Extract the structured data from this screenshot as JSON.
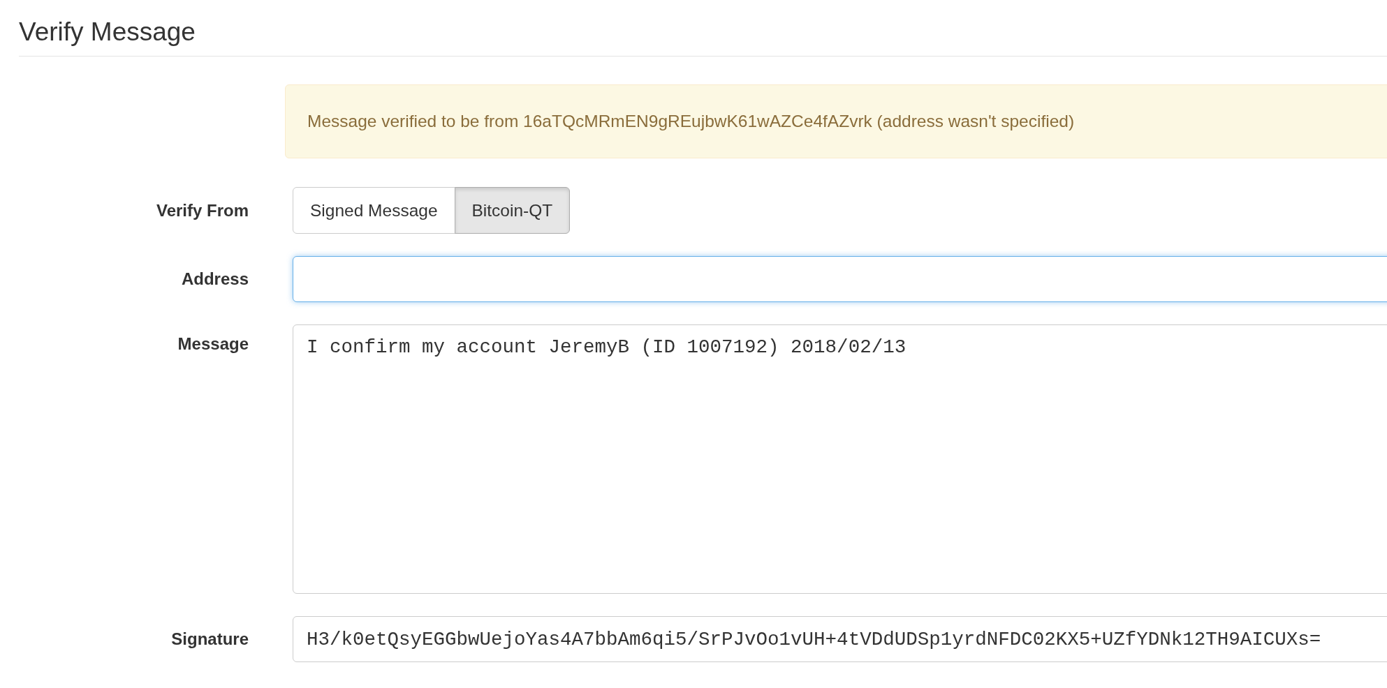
{
  "heading": "Verify Message",
  "alert": {
    "text": "Message verified to be from 16aTQcMRmEN9gREujbwK61wAZCe4fAZvrk (address wasn't specified)"
  },
  "form": [
    {
      "kind": "toggle",
      "label": "Verify From",
      "options": [
        {
          "label": "Signed Message",
          "selected": false
        },
        {
          "label": "Bitcoin-QT",
          "selected": true
        }
      ]
    },
    {
      "kind": "input",
      "label": "Address",
      "focused": true
    },
    {
      "kind": "textarea",
      "label": "Message",
      "value": "I confirm my account JeremyB (ID 1007192) 2018/02/13"
    },
    {
      "kind": "input",
      "label": "Signature",
      "value": "H3/k0etQsyEGGbwUejoYas4A7bbAm6qi5/SrPJvOo1vUH+4tVDdUDSp1yrdNFDC02KX5+UZfYDNk12TH9AICUXs=",
      "focused": false
    }
  ]
}
